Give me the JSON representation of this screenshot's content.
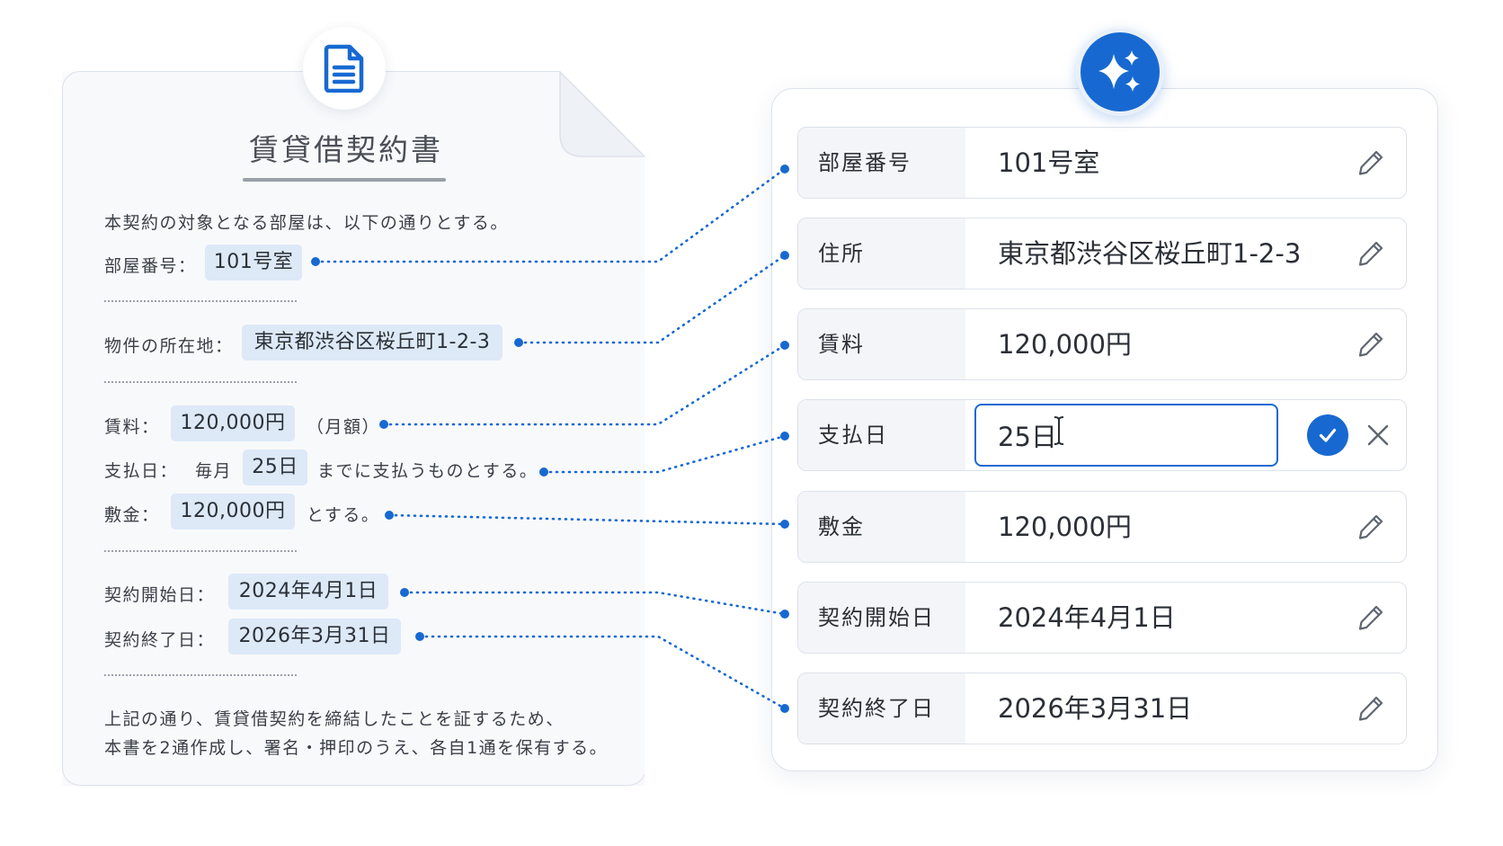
{
  "document": {
    "title": "賃貸借契約書",
    "intro": "本契約の対象となる部屋は、以下の通りとする。",
    "room_label": "部屋番号：",
    "room_value": "101号室",
    "address_label": "物件の所在地：",
    "address_value": "東京都渋谷区桜丘町1-2-3",
    "rent_label": "賃料：",
    "rent_value": "120,000円",
    "rent_suffix": "（月額）",
    "payday_label": "支払日：",
    "payday_prefix": "毎月",
    "payday_value": "25日",
    "payday_suffix": "までに支払うものとする。",
    "deposit_label": "敷金：",
    "deposit_value": "120,000円",
    "deposit_suffix": "とする。",
    "start_label": "契約開始日：",
    "start_value": "2024年4月1日",
    "end_label": "契約終了日：",
    "end_value": "2026年3月31日",
    "closing_line1": "上記の通り、賃貸借契約を締結したことを証するため、",
    "closing_line2": "本書を2通作成し、署名・押印のうえ、各自1通を保有する。"
  },
  "fields": [
    {
      "label": "部屋番号",
      "value": "101号室"
    },
    {
      "label": "住所",
      "value": "東京都渋谷区桜丘町1-2-3"
    },
    {
      "label": "賃料",
      "value": "120,000円"
    },
    {
      "label": "支払日",
      "value": "25日",
      "editing": true
    },
    {
      "label": "敷金",
      "value": "120,000円"
    },
    {
      "label": "契約開始日",
      "value": "2024年4月1日"
    },
    {
      "label": "契約終了日",
      "value": "2026年3月31日"
    }
  ],
  "icons": {
    "document": "document-icon",
    "ai": "sparkles-icon",
    "edit": "pencil-icon",
    "confirm": "check-icon",
    "cancel": "close-icon",
    "cursor": "text-cursor-icon"
  },
  "colors": {
    "accent": "#1769d1",
    "chip": "#dde9f7",
    "connector": "#1769d1"
  }
}
